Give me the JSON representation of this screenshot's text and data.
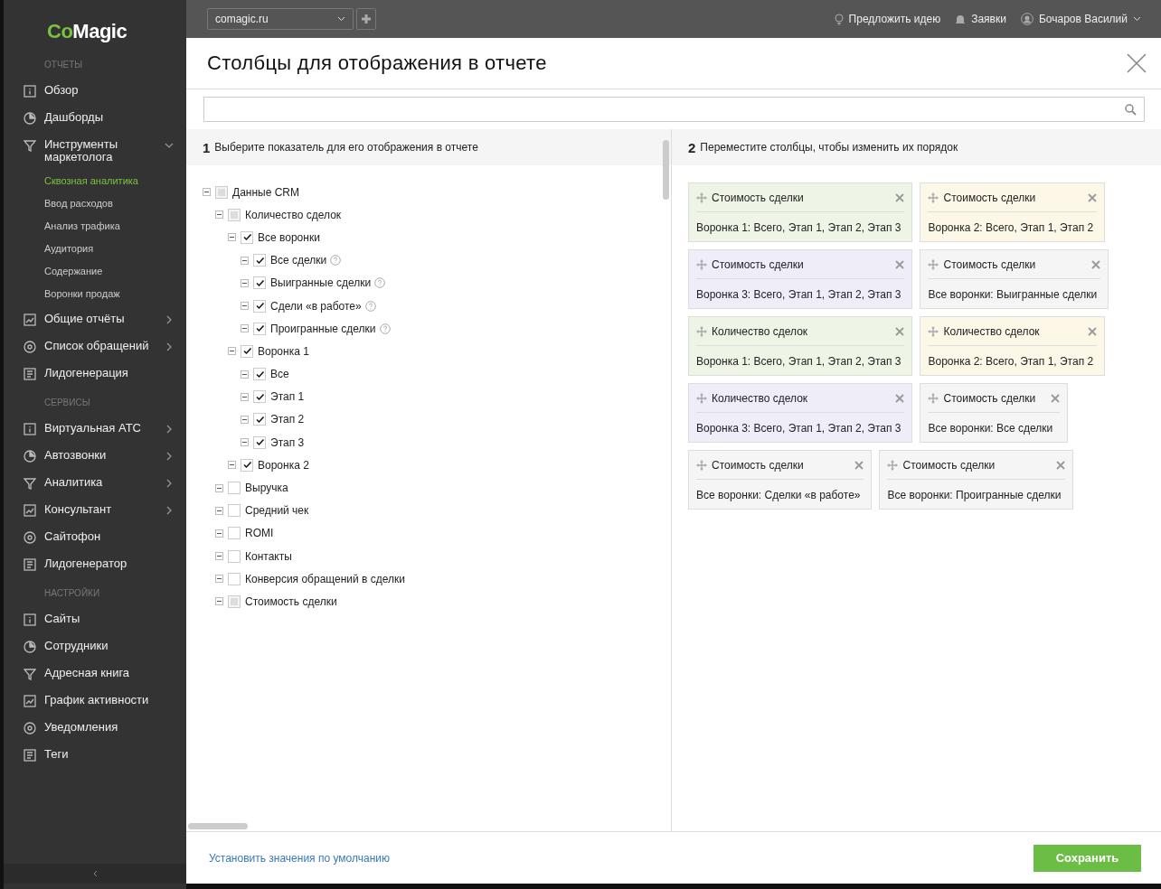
{
  "sidebar": {
    "logo": {
      "part_1": "Co",
      "part_2": "Magic"
    },
    "sections": [
      {
        "heading": "ОТЧЕТЫ",
        "items": [
          {
            "label": "Обзор"
          },
          {
            "label": "Дашборды"
          },
          {
            "label": "Инструменты маркетолога",
            "expanded": true,
            "children": [
              {
                "label": "Сквозная аналитика",
                "selected": true
              },
              {
                "label": "Ввод расходов",
                "selected": false
              },
              {
                "label": "Анализ трафика",
                "selected": false
              },
              {
                "label": "Аудитория",
                "selected": false
              },
              {
                "label": "Содержание",
                "selected": false
              },
              {
                "label": "Воронки продаж",
                "selected": false
              }
            ]
          },
          {
            "label": "Общие отчёты",
            "expanded": false
          },
          {
            "label": "Список обращений",
            "expanded": false
          },
          {
            "label": "Лидогенерация"
          }
        ]
      },
      {
        "heading": "СЕРВИСЫ",
        "items": [
          {
            "label": "Виртуальная АТС",
            "expanded": false
          },
          {
            "label": "Автозвонки",
            "expanded": false
          },
          {
            "label": "Аналитика",
            "expanded": false
          },
          {
            "label": "Консультант",
            "expanded": false
          },
          {
            "label": "Сайтофон"
          },
          {
            "label": "Лидогенератор"
          }
        ]
      },
      {
        "heading": "НАСТРОЙКИ",
        "items": [
          {
            "label": "Сайты"
          },
          {
            "label": "Сотрудники"
          },
          {
            "label": "Адресная книга"
          },
          {
            "label": "График активности"
          },
          {
            "label": "Уведомления"
          },
          {
            "label": "Теги"
          }
        ]
      }
    ]
  },
  "topbar": {
    "site_select": {
      "value": "comagic.ru"
    },
    "links": [
      "Предложить идею",
      "Заявки"
    ],
    "user": "Бочаров Василий"
  },
  "dialog": {
    "title": "Столбцы для отображения в отчете",
    "step_1": {
      "number": "1",
      "text": "Выберите показатель для его отображения в отчете"
    },
    "step_2": {
      "number": "2",
      "text": "Переместите столбцы, чтобы изменить их порядок"
    },
    "tree": [
      {
        "label": "Данные CRM",
        "checked": false,
        "partial": true,
        "children": [
          {
            "label": "Количество сделок",
            "checked": false,
            "partial": true,
            "children": [
              {
                "label": "Все воронки",
                "checked": true,
                "children": [
                  {
                    "label": "Все сделки",
                    "checked": true,
                    "help": true
                  },
                  {
                    "label": "Выигранные сделки",
                    "checked": true,
                    "help": true
                  },
                  {
                    "label": "Сдели «в работе»",
                    "checked": true,
                    "help": true
                  },
                  {
                    "label": "Проигранные сделки",
                    "checked": true,
                    "help": true
                  }
                ]
              },
              {
                "label": "Воронка 1",
                "checked": true,
                "children": [
                  {
                    "label": "Все",
                    "checked": true
                  },
                  {
                    "label": "Этап 1",
                    "checked": true
                  },
                  {
                    "label": "Этап 2",
                    "checked": true
                  },
                  {
                    "label": "Этап 3",
                    "checked": true
                  }
                ]
              },
              {
                "label": "Воронка 2",
                "checked": true
              }
            ]
          },
          {
            "label": "Выручка",
            "checked": false,
            "partial": false
          },
          {
            "label": "Средний чек",
            "checked": false,
            "partial": false
          },
          {
            "label": "ROMI",
            "checked": false,
            "partial": false
          },
          {
            "label": "Контакты",
            "checked": false,
            "partial": false
          },
          {
            "label": "Конверсия обращений в сделки",
            "checked": false,
            "partial": false
          },
          {
            "label": "Стоимость сделки",
            "checked": false,
            "partial": true
          }
        ]
      }
    ],
    "columns": [
      {
        "title": "Стоимость сделки",
        "detail": "Воронка 1: Всего, Этап 1, Этап 2, Этап 3",
        "color": "#eef5e6"
      },
      {
        "title": "Стоимость сделки",
        "detail": "Воронка 2: Всего, Этап 1, Этап 2",
        "color": "#fdf7e8"
      },
      {
        "title": "Стоимость сделки",
        "detail": "Воронка 3: Всего, Этап 1, Этап 2, Этап 3",
        "color": "#eeedf8"
      },
      {
        "title": "Стоимость сделки",
        "detail": "Все воронки: Выигранные сделки",
        "color": "#f5f5f5"
      },
      {
        "title": "Количество сделок",
        "detail": "Воронка 1: Всего, Этап 1, Этап 2, Этап 3",
        "color": "#eef5e6"
      },
      {
        "title": "Количество сделок",
        "detail": "Воронка 2: Всего, Этап 1, Этап 2",
        "color": "#fdf7e8"
      },
      {
        "title": "Количество сделок",
        "detail": "Воронка 3: Всего, Этап 1, Этап 2, Этап 3",
        "color": "#eeedf8"
      },
      {
        "title": "Стоимость сделки",
        "detail": "Все воронки: Все сделки",
        "color": "#f5f5f5"
      },
      {
        "title": "Стоимость сделки",
        "detail": "Все воронки: Сделки «в работе»",
        "color": "#f5f5f5"
      },
      {
        "title": "Стоимость сделки",
        "detail": "Все воронки: Проигранные сделки",
        "color": "#f5f5f5"
      }
    ],
    "footer": {
      "reset_link": "Установить значения по умолчанию",
      "save_button": "Сохранить"
    }
  }
}
